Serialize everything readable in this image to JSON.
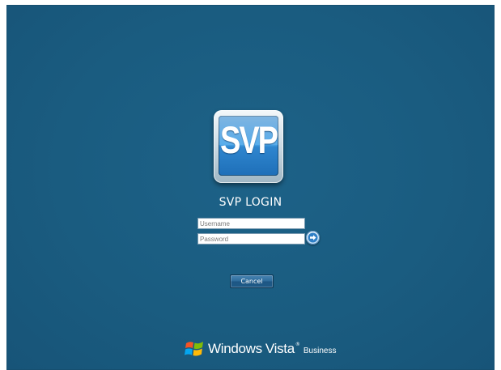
{
  "login": {
    "logo_text": "SVP",
    "title": "SVP LOGIN",
    "username_placeholder": "Username",
    "password_placeholder": "Password",
    "username_value": "",
    "password_value": "",
    "submit_icon": "arrow-right-icon",
    "cancel_label": "Cancel"
  },
  "branding": {
    "logo_icon": "windows-flag-icon",
    "word_windows": "Windows",
    "word_vista": "Vista",
    "trademark": "®",
    "edition": "Business"
  },
  "colors": {
    "background": "#1a5c80",
    "tile_blue": "#3d8fd2",
    "text": "#ffffff"
  }
}
